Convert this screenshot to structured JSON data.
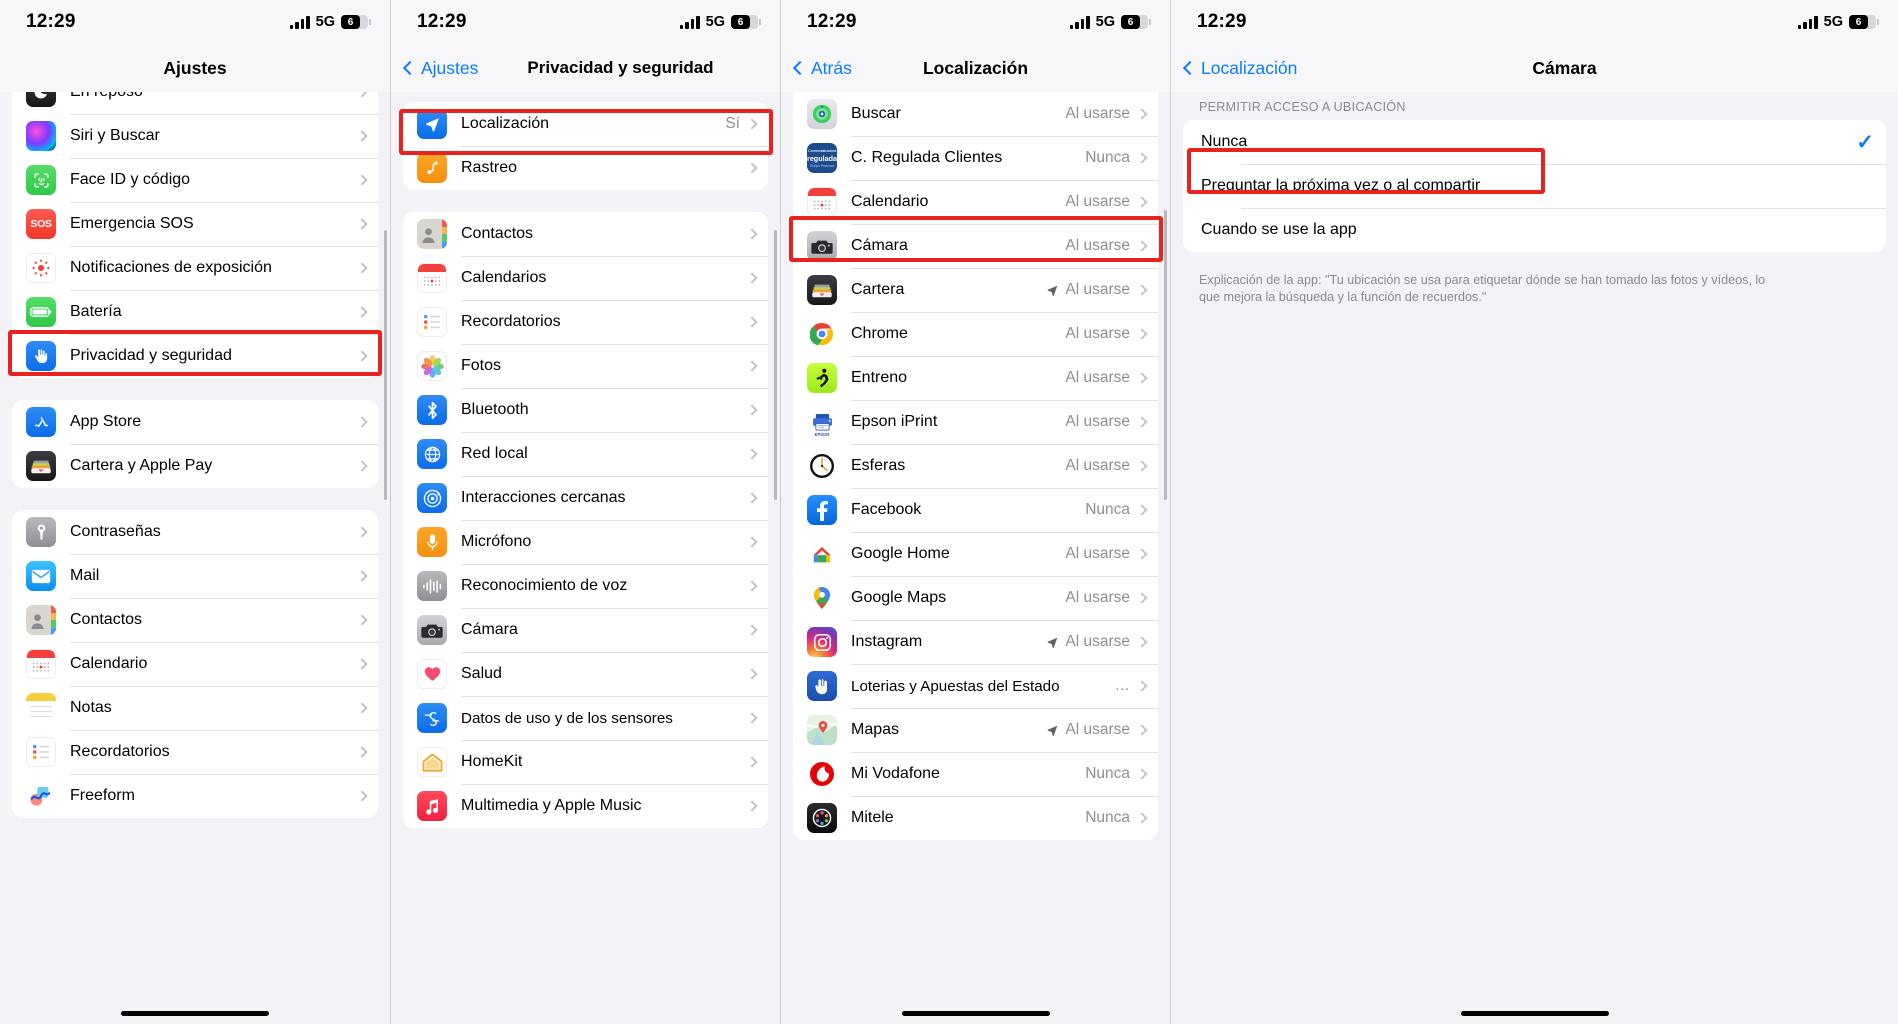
{
  "status": {
    "time": "12:29",
    "network": "5G",
    "battery_level": "6",
    "signal_icon": "cellular-bars-icon",
    "battery_icon": "battery-icon"
  },
  "screen1": {
    "title": "Ajustes",
    "groups": [
      {
        "items": [
          {
            "label": "En reposo",
            "icon": "sleep-icon"
          },
          {
            "label": "Siri y Buscar",
            "icon": "siri-icon"
          },
          {
            "label": "Face ID y código",
            "icon": "faceid-icon"
          },
          {
            "label": "Emergencia SOS",
            "icon": "sos-icon"
          },
          {
            "label": "Notificaciones de exposición",
            "icon": "exposure-icon"
          },
          {
            "label": "Batería",
            "icon": "battery-app-icon"
          },
          {
            "label": "Privacidad y seguridad",
            "icon": "privacy-hand-icon"
          }
        ]
      },
      {
        "items": [
          {
            "label": "App Store",
            "icon": "appstore-icon"
          },
          {
            "label": "Cartera y Apple Pay",
            "icon": "wallet-icon"
          }
        ]
      },
      {
        "items": [
          {
            "label": "Contraseñas",
            "icon": "passwords-key-icon"
          },
          {
            "label": "Mail",
            "icon": "mail-icon"
          },
          {
            "label": "Contactos",
            "icon": "contacts-icon"
          },
          {
            "label": "Calendario",
            "icon": "calendar-icon"
          },
          {
            "label": "Notas",
            "icon": "notes-icon"
          },
          {
            "label": "Recordatorios",
            "icon": "reminders-icon"
          },
          {
            "label": "Freeform",
            "icon": "freeform-icon"
          }
        ]
      }
    ]
  },
  "screen2": {
    "back_label": "Ajustes",
    "title": "Privacidad y seguridad",
    "groups": [
      {
        "items": [
          {
            "label": "Localización",
            "icon": "location-arrow-icon",
            "value": "Sí"
          },
          {
            "label": "Rastreo",
            "icon": "tracking-icon",
            "value": ""
          }
        ]
      },
      {
        "items": [
          {
            "label": "Contactos",
            "icon": "contacts-icon",
            "value": ""
          },
          {
            "label": "Calendarios",
            "icon": "calendar-icon",
            "value": ""
          },
          {
            "label": "Recordatorios",
            "icon": "reminders-icon",
            "value": ""
          },
          {
            "label": "Fotos",
            "icon": "photos-icon",
            "value": ""
          },
          {
            "label": "Bluetooth",
            "icon": "bluetooth-icon",
            "value": ""
          },
          {
            "label": "Red local",
            "icon": "local-network-icon",
            "value": ""
          },
          {
            "label": "Interacciones cercanas",
            "icon": "nearby-interactions-icon",
            "value": ""
          },
          {
            "label": "Micrófono",
            "icon": "microphone-icon",
            "value": ""
          },
          {
            "label": "Reconocimiento de voz",
            "icon": "speech-recognition-icon",
            "value": ""
          },
          {
            "label": "Cámara",
            "icon": "camera-icon",
            "value": ""
          },
          {
            "label": "Salud",
            "icon": "health-heart-icon",
            "value": ""
          },
          {
            "label": "Datos de uso y de los sensores",
            "icon": "sensor-data-icon",
            "value": ""
          },
          {
            "label": "HomeKit",
            "icon": "homekit-icon",
            "value": ""
          },
          {
            "label": "Multimedia y Apple Music",
            "icon": "music-icon",
            "value": ""
          }
        ]
      }
    ]
  },
  "screen3": {
    "back_label": "Atrás",
    "title": "Localización",
    "items": [
      {
        "label": "Buscar",
        "icon": "findmy-icon",
        "value": "Al usarse",
        "arrow": false
      },
      {
        "label": "C. Regulada Clientes",
        "icon": "regulada-icon",
        "value": "Nunca",
        "arrow": false
      },
      {
        "label": "Calendario",
        "icon": "calendar-icon",
        "value": "Al usarse",
        "arrow": false
      },
      {
        "label": "Cámara",
        "icon": "camera-icon",
        "value": "Al usarse",
        "arrow": false
      },
      {
        "label": "Cartera",
        "icon": "wallet-icon",
        "value": "Al usarse",
        "arrow": true
      },
      {
        "label": "Chrome",
        "icon": "chrome-icon",
        "value": "Al usarse",
        "arrow": false
      },
      {
        "label": "Entreno",
        "icon": "workout-icon",
        "value": "Al usarse",
        "arrow": false
      },
      {
        "label": "Epson iPrint",
        "icon": "epson-icon",
        "value": "Al usarse",
        "arrow": false
      },
      {
        "label": "Esferas",
        "icon": "watchfaces-icon",
        "value": "Al usarse",
        "arrow": false
      },
      {
        "label": "Facebook",
        "icon": "facebook-icon",
        "value": "Nunca",
        "arrow": false
      },
      {
        "label": "Google Home",
        "icon": "google-home-icon",
        "value": "Al usarse",
        "arrow": false
      },
      {
        "label": "Google Maps",
        "icon": "google-maps-icon",
        "value": "Al usarse",
        "arrow": false
      },
      {
        "label": "Instagram",
        "icon": "instagram-icon",
        "value": "Al usarse",
        "arrow": true
      },
      {
        "label": "Loterias y Apuestas del Estado",
        "icon": "loterias-icon",
        "value": "…",
        "arrow": false
      },
      {
        "label": "Mapas",
        "icon": "maps-icon",
        "value": "Al usarse",
        "arrow": true
      },
      {
        "label": "Mi Vodafone",
        "icon": "vodafone-icon",
        "value": "Nunca",
        "arrow": false
      },
      {
        "label": "Mitele",
        "icon": "mitele-icon",
        "value": "Nunca",
        "arrow": false
      }
    ]
  },
  "screen4": {
    "back_label": "Localización",
    "title": "Cámara",
    "section_header": "PERMITIR ACCESO A UBICACIÓN",
    "options": [
      {
        "label": "Nunca",
        "selected": true
      },
      {
        "label": "Preguntar la próxima vez o al compartir",
        "selected": false
      },
      {
        "label": "Cuando se use la app",
        "selected": false
      }
    ],
    "footnote": "Explicación de la app: \"Tu ubicación se usa para etiquetar dónde se han tomado las fotos y vídeos, lo que mejora la búsqueda y la función de recuerdos.\"",
    "check_icon": "checkmark-icon"
  },
  "colors": {
    "accent": "#0a7bff",
    "highlight": "#e8231f",
    "bg": "#f2f2f7",
    "value_gray": "#8e8e93"
  }
}
